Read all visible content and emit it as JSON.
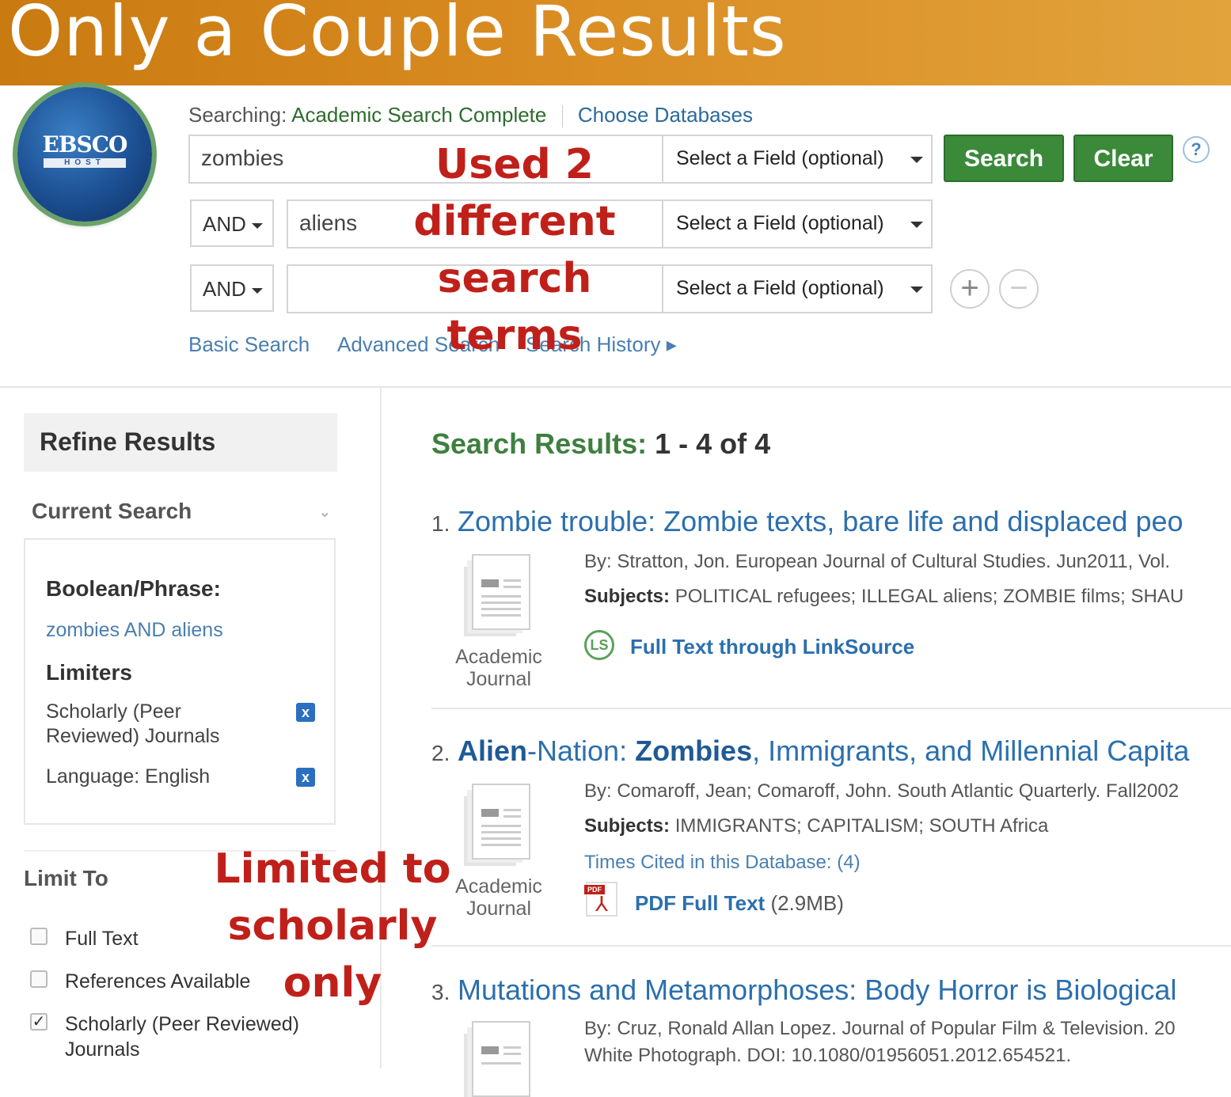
{
  "banner": {
    "title": "Only a Couple Results"
  },
  "logo": {
    "text": "EBSCO",
    "subtext": "HOST"
  },
  "search": {
    "searching_label": "Searching:",
    "database": "Academic Search Complete",
    "choose_databases": "Choose Databases",
    "rows": [
      {
        "operator": "",
        "term": "zombies",
        "field": "Select a Field (optional)"
      },
      {
        "operator": "AND",
        "term": "aliens",
        "field": "Select a Field (optional)"
      },
      {
        "operator": "AND",
        "term": "",
        "field": "Select a Field (optional)"
      }
    ],
    "search_button": "Search",
    "clear_button": "Clear",
    "help": "?",
    "add": "+",
    "remove": "−",
    "links": {
      "basic": "Basic Search",
      "advanced": "Advanced Search",
      "history": "Search History ▸"
    }
  },
  "annotations": {
    "search_terms": "Used 2 different search terms",
    "limiter": "Limited to scholarly only"
  },
  "refine": {
    "title": "Refine Results",
    "current_search": "Current Search",
    "boolean_label": "Boolean/Phrase:",
    "boolean_value": "zombies AND aliens",
    "limiters_label": "Limiters",
    "limiters": [
      {
        "label": "Scholarly (Peer Reviewed) Journals",
        "remove": "x"
      },
      {
        "label": "Language: English",
        "remove": "x"
      }
    ],
    "limit_to": "Limit To",
    "checkboxes": [
      {
        "label": "Full Text",
        "checked": false
      },
      {
        "label": "References Available",
        "checked": false
      },
      {
        "label": "Scholarly (Peer Reviewed) Journals",
        "checked": true
      }
    ]
  },
  "results": {
    "heading": "Search Results:",
    "count": "1 - 4 of 4",
    "items": [
      {
        "num": "1.",
        "title": "Zombie trouble: Zombie texts, bare life and displaced peo",
        "byline": "By: Stratton, Jon. European Journal of Cultural Studies. Jun2011, Vol.",
        "subjects_label": "Subjects:",
        "subjects": "POLITICAL refugees; ILLEGAL aliens; ZOMBIE films; SHAU",
        "type": "Academic Journal",
        "fulltext": "Full Text through LinkSource",
        "linksource_icon": "LS"
      },
      {
        "num": "2.",
        "title_part1": "Alien",
        "title_part2": "-Nation: ",
        "title_part3": "Zombies",
        "title_part4": ", Immigrants, and Millennial Capita",
        "byline": "By: Comaroff, Jean; Comaroff, John. South Atlantic Quarterly. Fall2002",
        "subjects_label": "Subjects:",
        "subjects": "IMMIGRANTS; CAPITALISM; SOUTH Africa",
        "times_cited": "Times Cited in this Database: (4)",
        "type": "Academic Journal",
        "pdf_label": "PDF Full Text",
        "pdf_size": "(2.9MB)",
        "pdf_tag": "PDF"
      },
      {
        "num": "3.",
        "title": "Mutations and Metamorphoses: Body Horror is Biological",
        "byline": "By: Cruz, Ronald Allan Lopez. Journal of Popular Film & Television. 20",
        "line2": "White Photograph. DOI: 10.1080/01956051.2012.654521."
      }
    ]
  }
}
